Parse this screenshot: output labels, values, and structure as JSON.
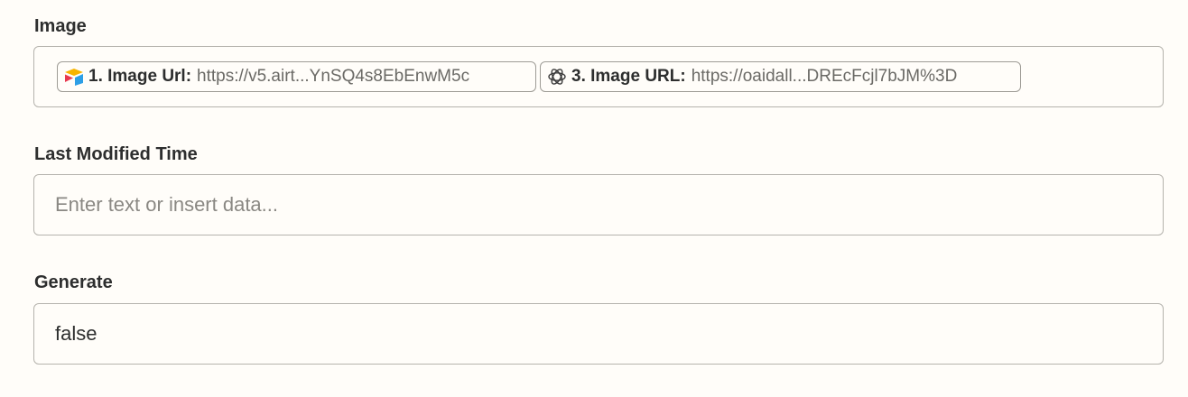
{
  "fields": {
    "image": {
      "label": "Image",
      "pills": [
        {
          "icon": "airtable-icon",
          "label": "1. Image Url:",
          "value": "https://v5.airt...YnSQ4s8EbEnwM5c"
        },
        {
          "icon": "openai-icon",
          "label": "3. Image URL:",
          "value": "https://oaidall...DREcFcjl7bJM%3D"
        }
      ]
    },
    "last_modified_time": {
      "label": "Last Modified Time",
      "placeholder": "Enter text or insert data..."
    },
    "generate": {
      "label": "Generate",
      "value": "false"
    }
  }
}
